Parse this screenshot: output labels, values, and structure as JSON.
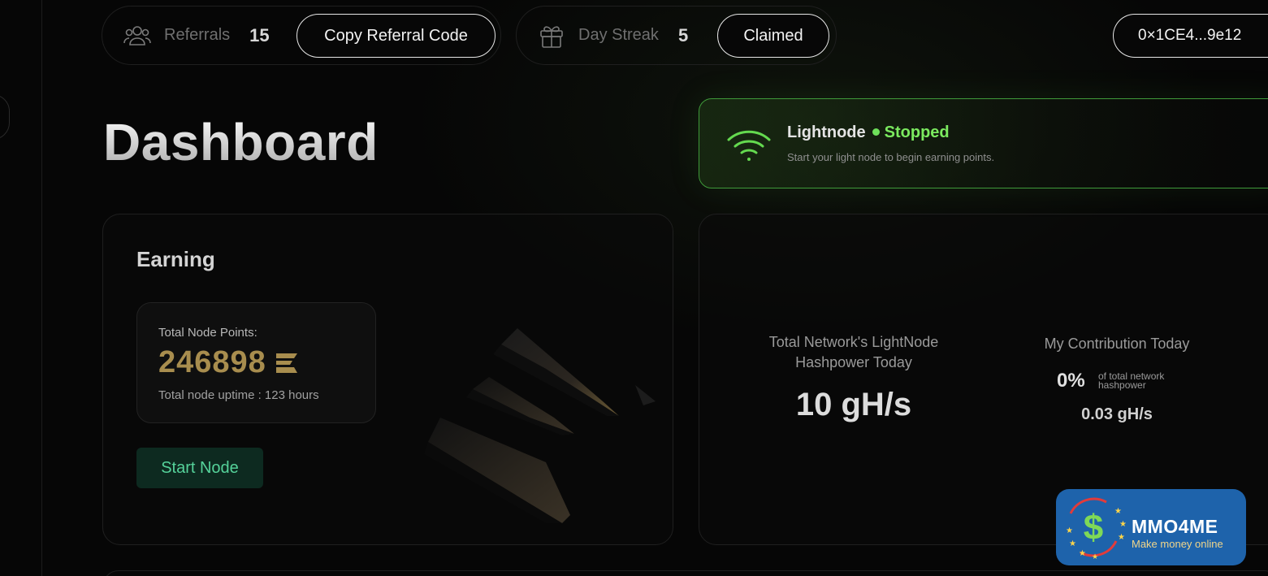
{
  "topbar": {
    "referrals": {
      "label": "Referrals",
      "count": "15",
      "button_label": "Copy Referral Code",
      "icon": "users-icon"
    },
    "streak": {
      "label": "Day Streak",
      "count": "5",
      "button_label": "Claimed",
      "icon": "gift-icon"
    },
    "wallet": {
      "address": "0×1CE4...9e12"
    }
  },
  "page": {
    "title": "Dashboard"
  },
  "lightnode": {
    "name": "Lightnode",
    "state": "Stopped",
    "description": "Start your light node to begin earning points.",
    "icon": "wifi-icon",
    "accent_color": "#7bea5f"
  },
  "earning": {
    "title": "Earning",
    "points_label": "Total Node Points:",
    "points_value": "246898",
    "uptime": "Total node uptime : 123 hours",
    "start_button": "Start Node",
    "points_color": "#a88d4e"
  },
  "hashpower": {
    "network_label": "Total Network's LightNode Hashpower Today",
    "network_value": "10 gH/s",
    "my_label": "My Contribution Today",
    "my_percent": "0%",
    "my_percent_note": "of total network hashpower",
    "my_value": "0.03 gH/s"
  },
  "watermark": {
    "brand": "MMO4ME",
    "tagline": "Make money online",
    "symbol": "$",
    "color": "#1e63ab"
  }
}
